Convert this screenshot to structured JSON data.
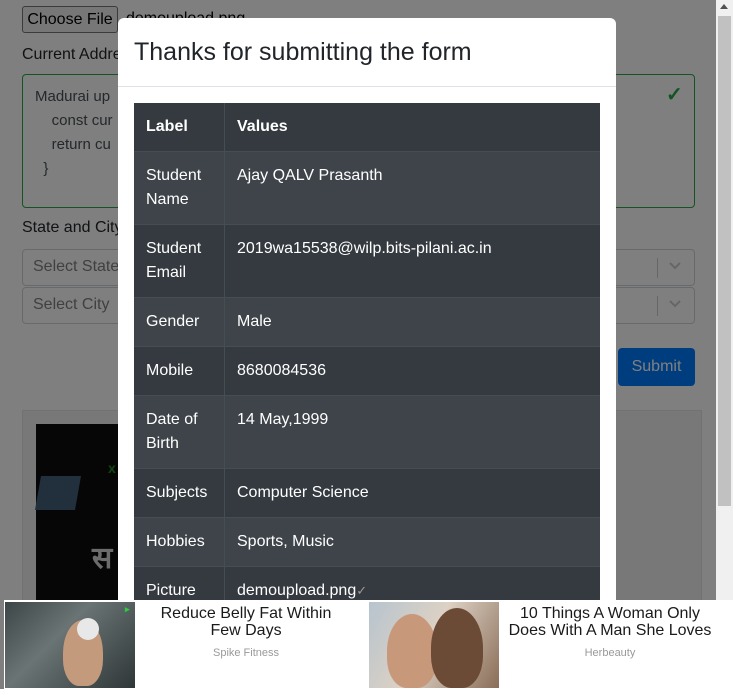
{
  "form": {
    "file_button": "Choose File",
    "file_name": "demoupload.png",
    "address_label": "Current Address",
    "address_value": "Madurai up\n    const cur\n    return cu\n  }",
    "state_city_label": "State and City",
    "state_placeholder": "Select State",
    "city_placeholder": "Select City",
    "submit_label": "Submit"
  },
  "modal": {
    "title": "Thanks for submitting the form",
    "header": {
      "label": "Label",
      "value": "Values"
    },
    "rows": [
      {
        "label": "Student Name",
        "value": "Ajay QALV Prasanth"
      },
      {
        "label": "Student Email",
        "value": "2019wa15538@wilp.bits-pilani.ac.in"
      },
      {
        "label": "Gender",
        "value": "Male"
      },
      {
        "label": "Mobile",
        "value": "8680084536"
      },
      {
        "label": "Date of Birth",
        "value": "14 May,1999"
      },
      {
        "label": "Subjects",
        "value": "Computer Science"
      },
      {
        "label": "Hobbies",
        "value": "Sports, Music"
      },
      {
        "label": "Picture",
        "value": "demoupload.png"
      }
    ]
  },
  "ads": {
    "ad1": {
      "headline": "Reduce Belly Fat Within Few Days",
      "source": "Spike Fitness"
    },
    "ad2": {
      "headline": "10 Things A Woman Only Does With A Man She Loves",
      "source": "Herbeauty"
    }
  },
  "colors": {
    "valid": "#28a745",
    "primary": "#007bff",
    "table_dark": "#343a40"
  },
  "icons": {
    "valid": "check-icon",
    "select": "chevron-down-icon",
    "scroll": "scroll-up-arrow-icon"
  }
}
